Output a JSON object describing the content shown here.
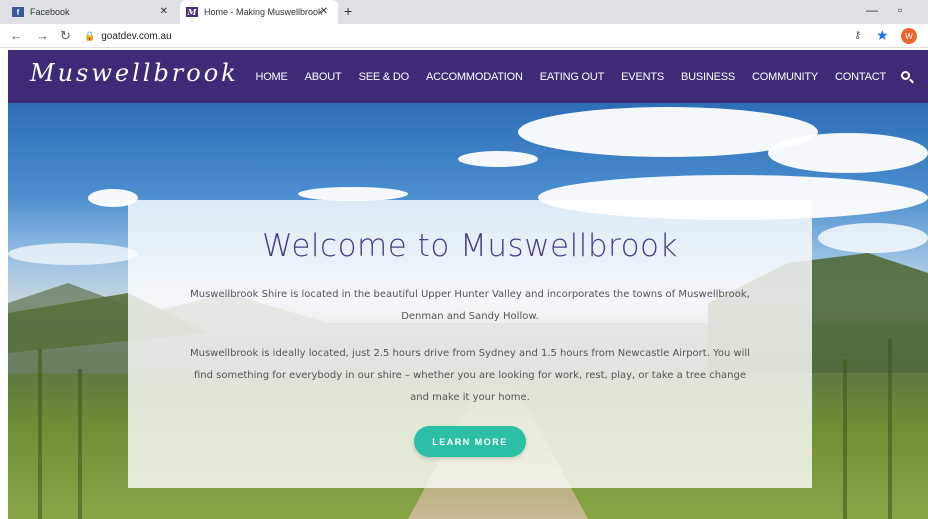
{
  "browser": {
    "tabs": [
      {
        "label": "Facebook",
        "favicon": "facebook-icon"
      },
      {
        "label": "Home - Making Muswellbrook",
        "favicon": "muswellbrook-icon"
      }
    ],
    "url": "goatdev.com.au",
    "profile_initial": "W"
  },
  "site": {
    "logo": "Muswellbrook",
    "nav": [
      "HOME",
      "ABOUT",
      "SEE & DO",
      "ACCOMMODATION",
      "EATING OUT",
      "EVENTS",
      "BUSINESS",
      "COMMUNITY",
      "CONTACT"
    ],
    "header_color": "#3f2a78"
  },
  "hero": {
    "title": "Welcome to Muswellbrook",
    "para1": "Muswellbrook Shire is located in the beautiful Upper Hunter Valley and incorporates the towns of Muswellbrook, Denman and Sandy Hollow.",
    "para2": "Muswellbrook is ideally located, just 2.5 hours drive from Sydney and 1.5 hours from Newcastle Airport.  You will find something for everybody in our shire – whether you are looking for work, rest, play, or take a tree change and make it your home.",
    "button": "LEARN MORE",
    "button_color": "#2bbfa6"
  }
}
